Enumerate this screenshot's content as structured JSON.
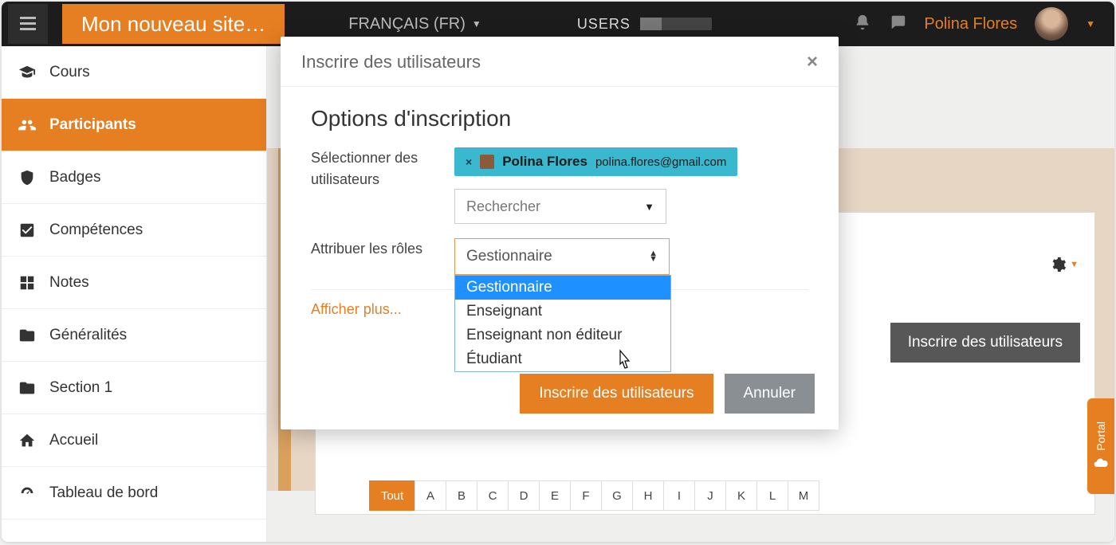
{
  "topbar": {
    "brand": "Mon nouveau site…",
    "language": "FRANÇAIS (FR)",
    "users_label": "USERS",
    "user_name": "Polina Flores"
  },
  "sidebar": {
    "items": [
      {
        "label": "Cours",
        "icon": "graduation"
      },
      {
        "label": "Participants",
        "icon": "users",
        "active": true
      },
      {
        "label": "Badges",
        "icon": "shield"
      },
      {
        "label": "Compétences",
        "icon": "check-square"
      },
      {
        "label": "Notes",
        "icon": "grid"
      },
      {
        "label": "Généralités",
        "icon": "folder"
      },
      {
        "label": "Section 1",
        "icon": "folder"
      },
      {
        "label": "Accueil",
        "icon": "home"
      },
      {
        "label": "Tableau de bord",
        "icon": "dashboard"
      }
    ]
  },
  "page": {
    "enrol_button": "Inscrire des utilisateurs",
    "alpha_all": "Tout",
    "alpha": [
      "A",
      "B",
      "C",
      "D",
      "E",
      "F",
      "G",
      "H",
      "I",
      "J",
      "K",
      "L",
      "M"
    ]
  },
  "modal": {
    "title": "Inscrire des utilisateurs",
    "section_title": "Options d'inscription",
    "select_users_label": "Sélectionner des utilisateurs",
    "selected_user": {
      "name": "Polina Flores",
      "email": "polina.flores@gmail.com"
    },
    "search_placeholder": "Rechercher",
    "assign_roles_label": "Attribuer les rôles",
    "role_selected": "Gestionnaire",
    "role_options": [
      "Gestionnaire",
      "Enseignant",
      "Enseignant non éditeur",
      "Étudiant"
    ],
    "show_more": "Afficher plus...",
    "submit": "Inscrire des utilisateurs",
    "cancel": "Annuler"
  },
  "portal": {
    "label": "Portal"
  }
}
